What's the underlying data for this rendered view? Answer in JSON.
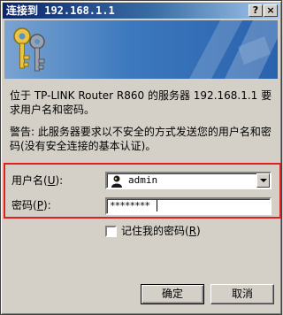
{
  "window": {
    "title": "连接到 192.168.1.1",
    "help_label": "?",
    "close_label": "×"
  },
  "banner": {
    "icon": "keys-icon",
    "colors": {
      "start": "#7aa3d0",
      "end": "#2a62ad"
    }
  },
  "message": {
    "description": "位于 TP-LINK Router R860 的服务器 192.168.1.1 要求用户名和密码。",
    "warning": "警告: 此服务器要求以不安全的方式发送您的用户名和密码(没有安全连接的基本认证)。"
  },
  "form": {
    "username_label": "用户名",
    "username_hotkey": "U",
    "username_value": "admin",
    "username_icon": "user-icon",
    "password_label": "密码",
    "password_hotkey": "P",
    "password_value": "********",
    "remember_label": "记住我的密码",
    "remember_hotkey": "R",
    "remember_checked": false,
    "highlight_color": "#e02020"
  },
  "buttons": {
    "ok_label": "确定",
    "cancel_label": "取消"
  }
}
